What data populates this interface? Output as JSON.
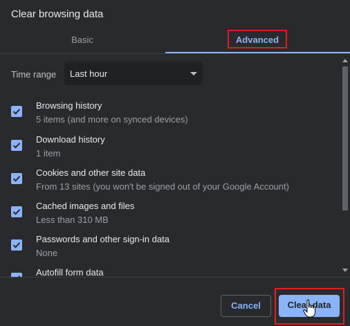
{
  "dialog": {
    "title": "Clear browsing data"
  },
  "tabs": [
    {
      "label": "Basic",
      "active": false
    },
    {
      "label": "Advanced",
      "active": true
    }
  ],
  "time_range": {
    "label": "Time range",
    "value": "Last hour"
  },
  "items": [
    {
      "title": "Browsing history",
      "subtitle": "5 items (and more on synced devices)",
      "checked": true
    },
    {
      "title": "Download history",
      "subtitle": "1 item",
      "checked": true
    },
    {
      "title": "Cookies and other site data",
      "subtitle": "From 13 sites (you won't be signed out of your Google Account)",
      "checked": true
    },
    {
      "title": "Cached images and files",
      "subtitle": "Less than 310 MB",
      "checked": true
    },
    {
      "title": "Passwords and other sign-in data",
      "subtitle": "None",
      "checked": true
    },
    {
      "title": "Autofill form data",
      "subtitle": "",
      "checked": true
    }
  ],
  "buttons": {
    "cancel": "Cancel",
    "clear": "Clear data"
  },
  "colors": {
    "background": "#292a2d",
    "accent": "#8ab4f8",
    "highlight": "#e21d23"
  }
}
